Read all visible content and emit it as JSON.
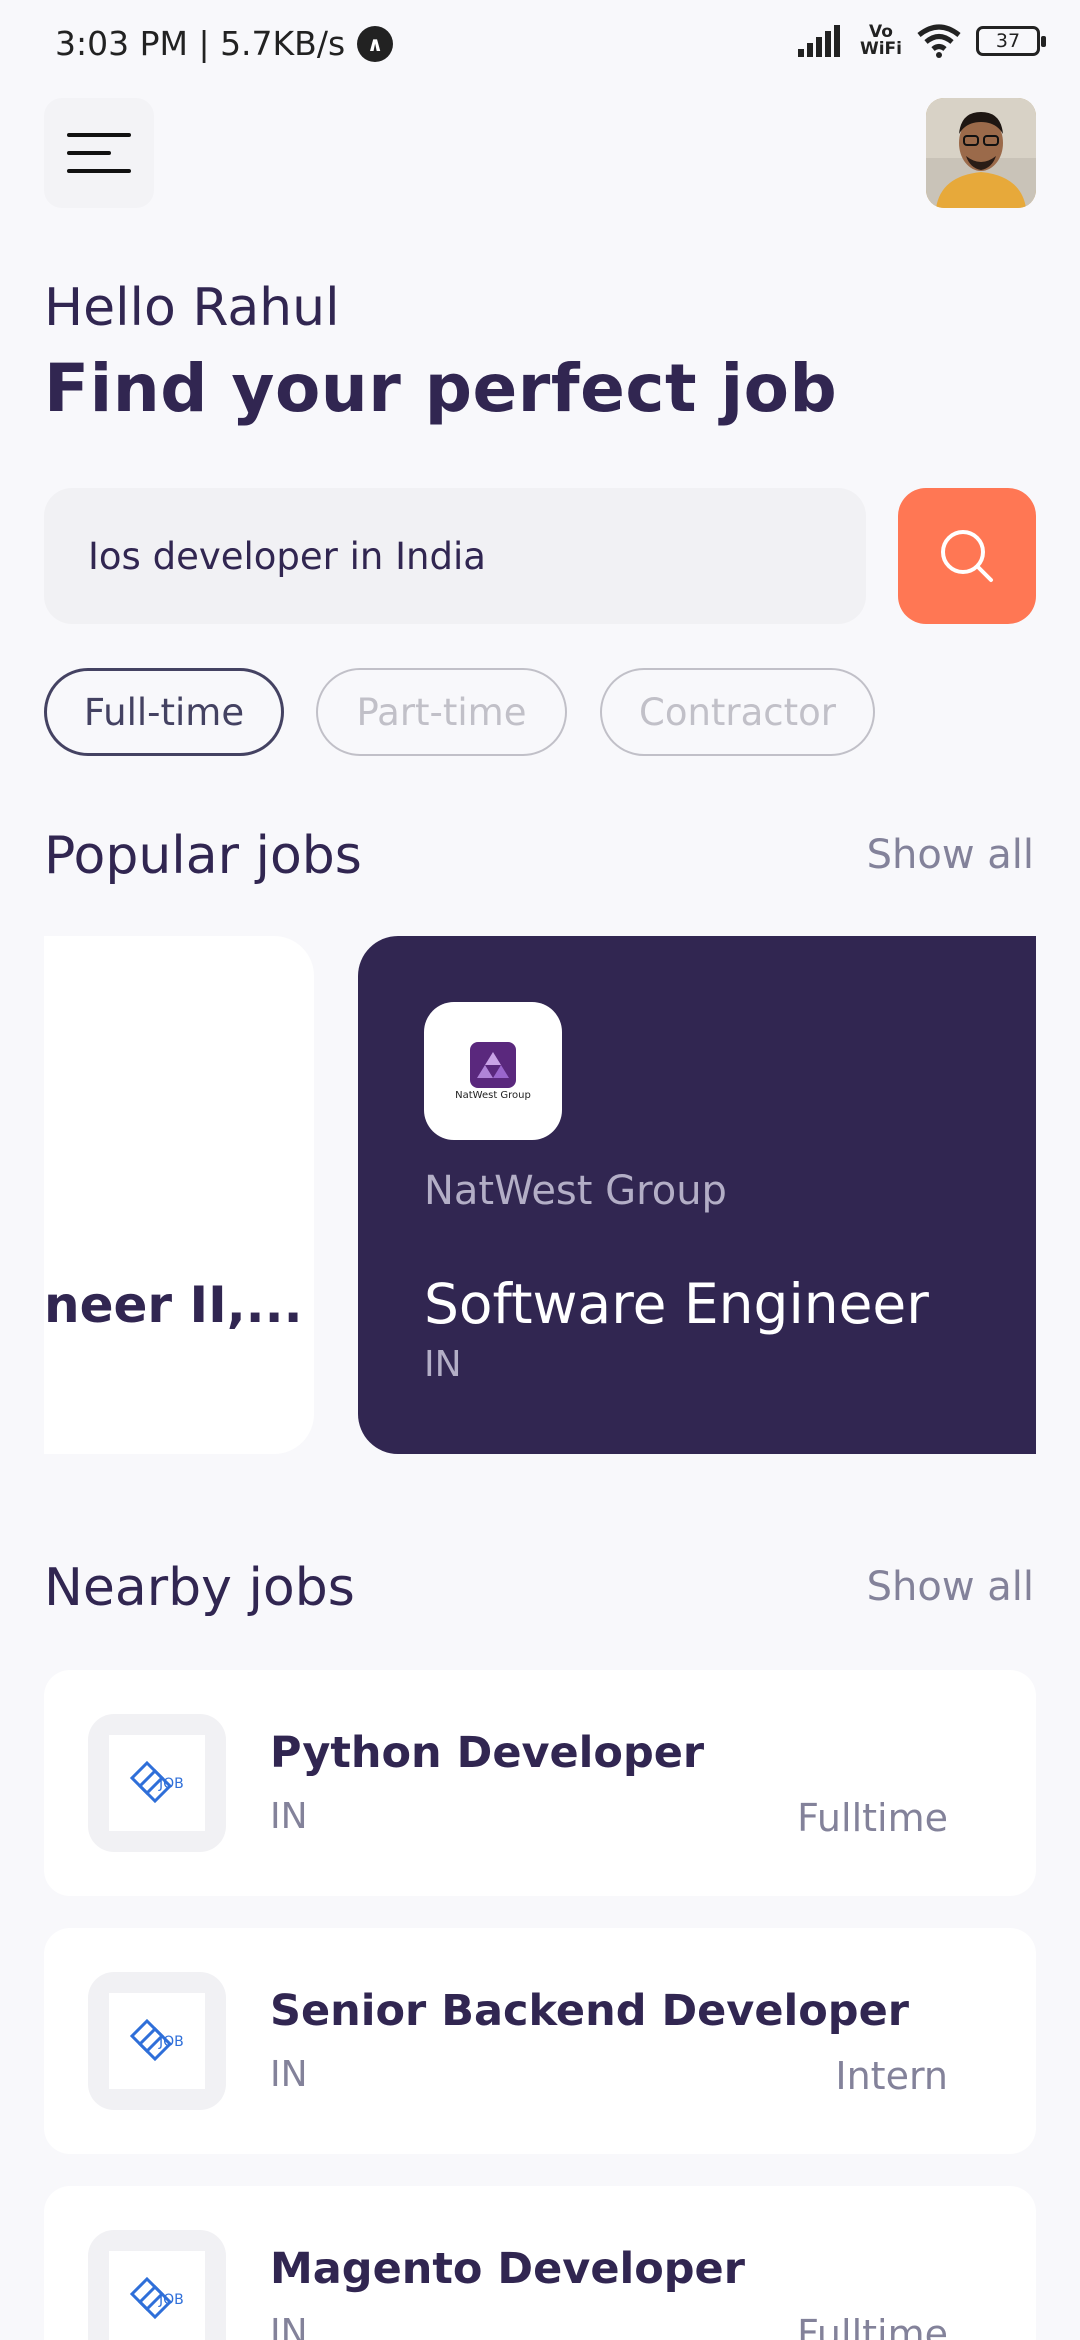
{
  "status_bar": {
    "time": "3:03 PM | 5.7KB/s",
    "vowifi_top": "Vo",
    "vowifi_bottom": "WiFi",
    "battery": "37"
  },
  "header": {
    "menu_icon": "menu-icon",
    "avatar_alt": "profile avatar"
  },
  "greeting": "Hello Rahul",
  "headline": "Find your perfect job",
  "search": {
    "value": "Ios developer in India",
    "icon": "search-icon"
  },
  "job_types": [
    {
      "label": "Full-time",
      "active": true
    },
    {
      "label": "Part-time",
      "active": false
    },
    {
      "label": "Contractor",
      "active": false
    }
  ],
  "popular": {
    "title": "Popular jobs",
    "show_all": "Show all",
    "cards": [
      {
        "title": "neer II,..."
      },
      {
        "company": "NatWest Group",
        "logo_text": "NatWest Group",
        "title": "Software Engineer",
        "country": "IN"
      }
    ]
  },
  "nearby": {
    "title": "Nearby jobs",
    "show_all": "Show all",
    "items": [
      {
        "title": "Python Developer",
        "country": "IN",
        "type": "Fulltime",
        "logo_text": "JOB"
      },
      {
        "title": "Senior Backend Developer",
        "country": "IN",
        "type": "Intern",
        "logo_text": "JOB"
      },
      {
        "title": "Magento Developer",
        "country": "IN",
        "type": "Fulltime",
        "logo_text": "JOB"
      }
    ]
  },
  "colors": {
    "primary": "#312651",
    "accent": "#FF7754",
    "background": "#F8F8FB",
    "gray": "#83829A"
  }
}
